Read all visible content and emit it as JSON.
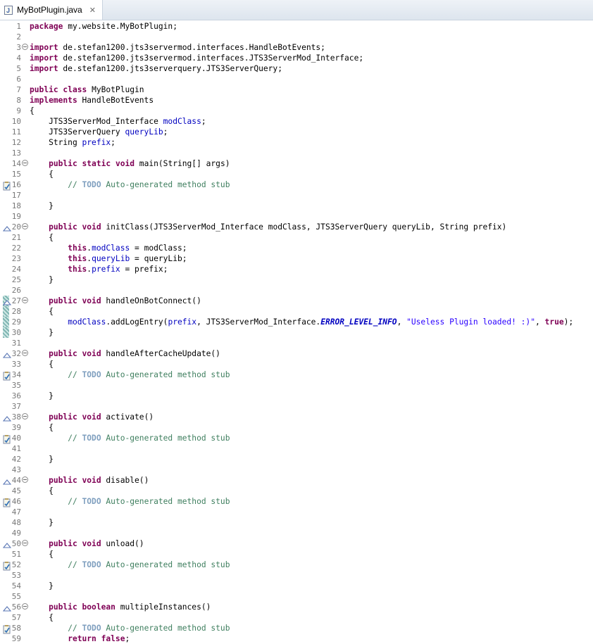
{
  "tab": {
    "filename": "MyBotPlugin.java",
    "icon_letter": "J",
    "close_glyph": "✕"
  },
  "gutter_markers": {
    "override": "override-triangle-icon",
    "task": "task-todo-icon",
    "change": "changed-lines-bar"
  },
  "colors": {
    "keyword": "#7f0055",
    "field": "#0000c0",
    "comment": "#3f7f5f",
    "string": "#2a00ff",
    "todo": "#7f9fbf",
    "line_number": "#787878"
  },
  "lines": [
    {
      "n": "1",
      "segs": [
        [
          "kw",
          "package"
        ],
        [
          "t",
          " my.website.MyBotPlugin;"
        ]
      ]
    },
    {
      "n": "2",
      "segs": []
    },
    {
      "n": "3",
      "fold": true,
      "segs": [
        [
          "kw",
          "import"
        ],
        [
          "t",
          " de.stefan1200.jts3servermod.interfaces.HandleBotEvents;"
        ]
      ]
    },
    {
      "n": "4",
      "segs": [
        [
          "kw",
          "import"
        ],
        [
          "t",
          " de.stefan1200.jts3servermod.interfaces.JTS3ServerMod_Interface;"
        ]
      ]
    },
    {
      "n": "5",
      "segs": [
        [
          "kw",
          "import"
        ],
        [
          "t",
          " de.stefan1200.jts3serverquery.JTS3ServerQuery;"
        ]
      ]
    },
    {
      "n": "6",
      "segs": []
    },
    {
      "n": "7",
      "segs": [
        [
          "kw",
          "public"
        ],
        [
          "t",
          " "
        ],
        [
          "kw",
          "class"
        ],
        [
          "t",
          " MyBotPlugin"
        ]
      ]
    },
    {
      "n": "8",
      "segs": [
        [
          "kw",
          "implements"
        ],
        [
          "t",
          " HandleBotEvents"
        ]
      ]
    },
    {
      "n": "9",
      "segs": [
        [
          "t",
          "{"
        ]
      ]
    },
    {
      "n": "10",
      "segs": [
        [
          "t",
          "    JTS3ServerMod_Interface "
        ],
        [
          "fld",
          "modClass"
        ],
        [
          "t",
          ";"
        ]
      ]
    },
    {
      "n": "11",
      "segs": [
        [
          "t",
          "    JTS3ServerQuery "
        ],
        [
          "fld",
          "queryLib"
        ],
        [
          "t",
          ";"
        ]
      ]
    },
    {
      "n": "12",
      "segs": [
        [
          "t",
          "    String "
        ],
        [
          "fld",
          "prefix"
        ],
        [
          "t",
          ";"
        ]
      ]
    },
    {
      "n": "13",
      "segs": []
    },
    {
      "n": "14",
      "fold": true,
      "segs": [
        [
          "t",
          "    "
        ],
        [
          "kw",
          "public"
        ],
        [
          "t",
          " "
        ],
        [
          "kw",
          "static"
        ],
        [
          "t",
          " "
        ],
        [
          "kw",
          "void"
        ],
        [
          "t",
          " main(String[] "
        ],
        [
          "t",
          "args"
        ],
        [
          "t",
          ")"
        ]
      ]
    },
    {
      "n": "15",
      "segs": [
        [
          "t",
          "    {"
        ]
      ]
    },
    {
      "n": "16",
      "marker": "task",
      "segs": [
        [
          "t",
          "        "
        ],
        [
          "cmt",
          "// "
        ],
        [
          "todo",
          "TODO"
        ],
        [
          "cmt",
          " Auto-generated method stub"
        ]
      ]
    },
    {
      "n": "17",
      "segs": []
    },
    {
      "n": "18",
      "segs": [
        [
          "t",
          "    }"
        ]
      ]
    },
    {
      "n": "19",
      "segs": []
    },
    {
      "n": "20",
      "fold": true,
      "marker": "override",
      "segs": [
        [
          "t",
          "    "
        ],
        [
          "kw",
          "public"
        ],
        [
          "t",
          " "
        ],
        [
          "kw",
          "void"
        ],
        [
          "t",
          " initClass(JTS3ServerMod_Interface modClass, JTS3ServerQuery queryLib, String prefix)"
        ]
      ]
    },
    {
      "n": "21",
      "segs": [
        [
          "t",
          "    {"
        ]
      ]
    },
    {
      "n": "22",
      "segs": [
        [
          "t",
          "        "
        ],
        [
          "kw",
          "this"
        ],
        [
          "t",
          "."
        ],
        [
          "fld",
          "modClass"
        ],
        [
          "t",
          " = modClass;"
        ]
      ]
    },
    {
      "n": "23",
      "segs": [
        [
          "t",
          "        "
        ],
        [
          "kw",
          "this"
        ],
        [
          "t",
          "."
        ],
        [
          "fld",
          "queryLib"
        ],
        [
          "t",
          " = queryLib;"
        ]
      ]
    },
    {
      "n": "24",
      "segs": [
        [
          "t",
          "        "
        ],
        [
          "kw",
          "this"
        ],
        [
          "t",
          "."
        ],
        [
          "fld",
          "prefix"
        ],
        [
          "t",
          " = prefix;"
        ]
      ]
    },
    {
      "n": "25",
      "segs": [
        [
          "t",
          "    }"
        ]
      ]
    },
    {
      "n": "26",
      "segs": []
    },
    {
      "n": "27",
      "fold": true,
      "marker": "override",
      "changed": true,
      "segs": [
        [
          "t",
          "    "
        ],
        [
          "kw",
          "public"
        ],
        [
          "t",
          " "
        ],
        [
          "kw",
          "void"
        ],
        [
          "t",
          " handleOnBotConnect()"
        ]
      ]
    },
    {
      "n": "28",
      "changed": true,
      "segs": [
        [
          "t",
          "    {"
        ]
      ]
    },
    {
      "n": "29",
      "changed": true,
      "segs": [
        [
          "t",
          "        "
        ],
        [
          "fld",
          "modClass"
        ],
        [
          "t",
          ".addLogEntry("
        ],
        [
          "fld",
          "prefix"
        ],
        [
          "t",
          ", JTS3ServerMod_Interface."
        ],
        [
          "stat",
          "ERROR_LEVEL_INFO"
        ],
        [
          "t",
          ", "
        ],
        [
          "str",
          "\"Useless Plugin loaded! :)\""
        ],
        [
          "t",
          ", "
        ],
        [
          "kw",
          "true"
        ],
        [
          "t",
          ");"
        ]
      ]
    },
    {
      "n": "30",
      "changed": true,
      "segs": [
        [
          "t",
          "    }"
        ]
      ]
    },
    {
      "n": "31",
      "segs": []
    },
    {
      "n": "32",
      "fold": true,
      "marker": "override",
      "segs": [
        [
          "t",
          "    "
        ],
        [
          "kw",
          "public"
        ],
        [
          "t",
          " "
        ],
        [
          "kw",
          "void"
        ],
        [
          "t",
          " handleAfterCacheUpdate()"
        ]
      ]
    },
    {
      "n": "33",
      "segs": [
        [
          "t",
          "    {"
        ]
      ]
    },
    {
      "n": "34",
      "marker": "task",
      "segs": [
        [
          "t",
          "        "
        ],
        [
          "cmt",
          "// "
        ],
        [
          "todo",
          "TODO"
        ],
        [
          "cmt",
          " Auto-generated method stub"
        ]
      ]
    },
    {
      "n": "35",
      "segs": []
    },
    {
      "n": "36",
      "segs": [
        [
          "t",
          "    }"
        ]
      ]
    },
    {
      "n": "37",
      "segs": []
    },
    {
      "n": "38",
      "fold": true,
      "marker": "override",
      "segs": [
        [
          "t",
          "    "
        ],
        [
          "kw",
          "public"
        ],
        [
          "t",
          " "
        ],
        [
          "kw",
          "void"
        ],
        [
          "t",
          " activate()"
        ]
      ]
    },
    {
      "n": "39",
      "segs": [
        [
          "t",
          "    {"
        ]
      ]
    },
    {
      "n": "40",
      "marker": "task",
      "segs": [
        [
          "t",
          "        "
        ],
        [
          "cmt",
          "// "
        ],
        [
          "todo",
          "TODO"
        ],
        [
          "cmt",
          " Auto-generated method stub"
        ]
      ]
    },
    {
      "n": "41",
      "segs": []
    },
    {
      "n": "42",
      "segs": [
        [
          "t",
          "    }"
        ]
      ]
    },
    {
      "n": "43",
      "segs": []
    },
    {
      "n": "44",
      "fold": true,
      "marker": "override",
      "segs": [
        [
          "t",
          "    "
        ],
        [
          "kw",
          "public"
        ],
        [
          "t",
          " "
        ],
        [
          "kw",
          "void"
        ],
        [
          "t",
          " disable()"
        ]
      ]
    },
    {
      "n": "45",
      "segs": [
        [
          "t",
          "    {"
        ]
      ]
    },
    {
      "n": "46",
      "marker": "task",
      "segs": [
        [
          "t",
          "        "
        ],
        [
          "cmt",
          "// "
        ],
        [
          "todo",
          "TODO"
        ],
        [
          "cmt",
          " Auto-generated method stub"
        ]
      ]
    },
    {
      "n": "47",
      "segs": []
    },
    {
      "n": "48",
      "segs": [
        [
          "t",
          "    }"
        ]
      ]
    },
    {
      "n": "49",
      "segs": []
    },
    {
      "n": "50",
      "fold": true,
      "marker": "override",
      "segs": [
        [
          "t",
          "    "
        ],
        [
          "kw",
          "public"
        ],
        [
          "t",
          " "
        ],
        [
          "kw",
          "void"
        ],
        [
          "t",
          " unload()"
        ]
      ]
    },
    {
      "n": "51",
      "segs": [
        [
          "t",
          "    {"
        ]
      ]
    },
    {
      "n": "52",
      "marker": "task",
      "segs": [
        [
          "t",
          "        "
        ],
        [
          "cmt",
          "// "
        ],
        [
          "todo",
          "TODO"
        ],
        [
          "cmt",
          " Auto-generated method stub"
        ]
      ]
    },
    {
      "n": "53",
      "segs": []
    },
    {
      "n": "54",
      "segs": [
        [
          "t",
          "    }"
        ]
      ]
    },
    {
      "n": "55",
      "segs": []
    },
    {
      "n": "56",
      "fold": true,
      "marker": "override",
      "segs": [
        [
          "t",
          "    "
        ],
        [
          "kw",
          "public"
        ],
        [
          "t",
          " "
        ],
        [
          "kw",
          "boolean"
        ],
        [
          "t",
          " multipleInstances()"
        ]
      ]
    },
    {
      "n": "57",
      "segs": [
        [
          "t",
          "    {"
        ]
      ]
    },
    {
      "n": "58",
      "marker": "task",
      "segs": [
        [
          "t",
          "        "
        ],
        [
          "cmt",
          "// "
        ],
        [
          "todo",
          "TODO"
        ],
        [
          "cmt",
          " Auto-generated method stub"
        ]
      ]
    },
    {
      "n": "59",
      "segs": [
        [
          "t",
          "        "
        ],
        [
          "kw",
          "return"
        ],
        [
          "t",
          " "
        ],
        [
          "kw",
          "false"
        ],
        [
          "t",
          ";"
        ]
      ]
    }
  ]
}
